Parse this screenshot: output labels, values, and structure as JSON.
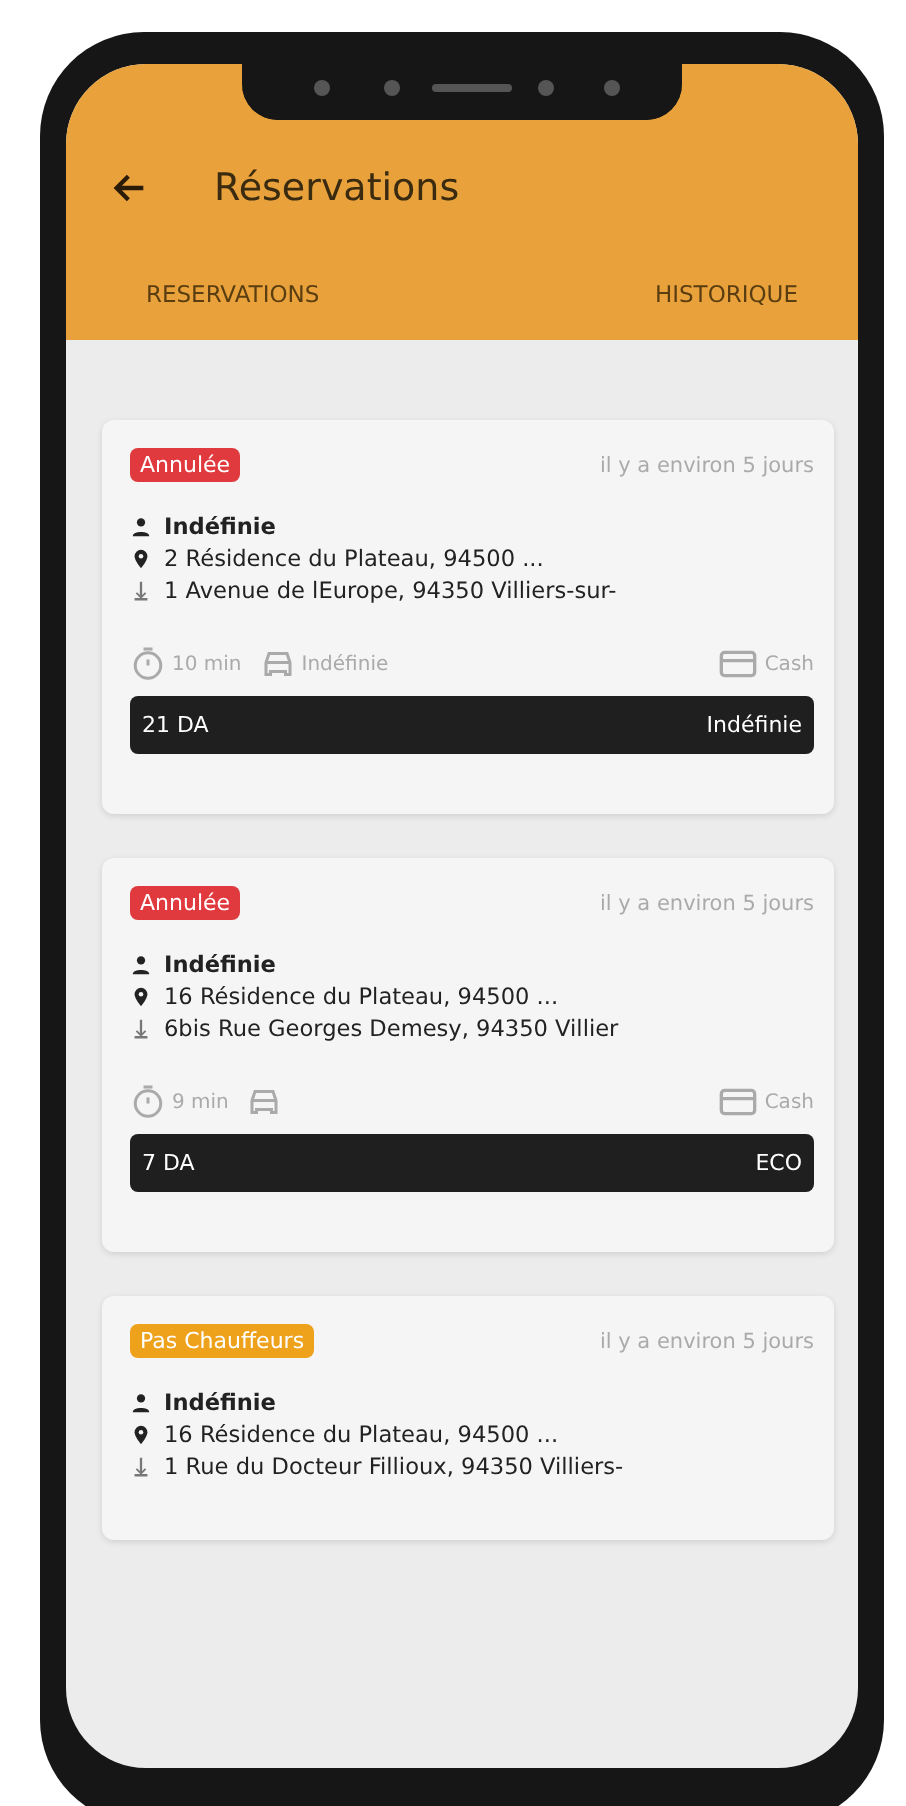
{
  "header": {
    "title": "Réservations"
  },
  "tabs": [
    {
      "label": "RESERVATIONS"
    },
    {
      "label": "HISTORIQUE"
    }
  ],
  "reservations": [
    {
      "status": "Annulée",
      "color": "#e0393e",
      "time": "il y a environ 5 jours",
      "client": "Indéfinie",
      "pickup": "2 Résidence du Plateau, 94500 ...",
      "dropoff": "1 Avenue de lEurope, 94350 Villiers-sur-",
      "duration": "10 min",
      "vehicle": "Indéfinie",
      "payment": "Cash",
      "price": "21 DA",
      "category": "Indéfinie"
    },
    {
      "status": "Annulée",
      "color": "#e0393e",
      "time": "il y a environ 5 jours",
      "client": "Indéfinie",
      "pickup": "16 Résidence du Plateau, 94500 ...",
      "dropoff": "6bis Rue Georges Demesy, 94350 Villier",
      "duration": "9 min",
      "payment": "Cash",
      "price": "7 DA",
      "category": "ECO"
    },
    {
      "status": "Pas Chauffeurs",
      "color": "#eea21c",
      "time": "il y a environ 5 jours",
      "client": "Indéfinie",
      "pickup": "16 Résidence du Plateau, 94500 ...",
      "dropoff": "1 Rue du Docteur Fillioux, 94350 Villiers-"
    }
  ]
}
